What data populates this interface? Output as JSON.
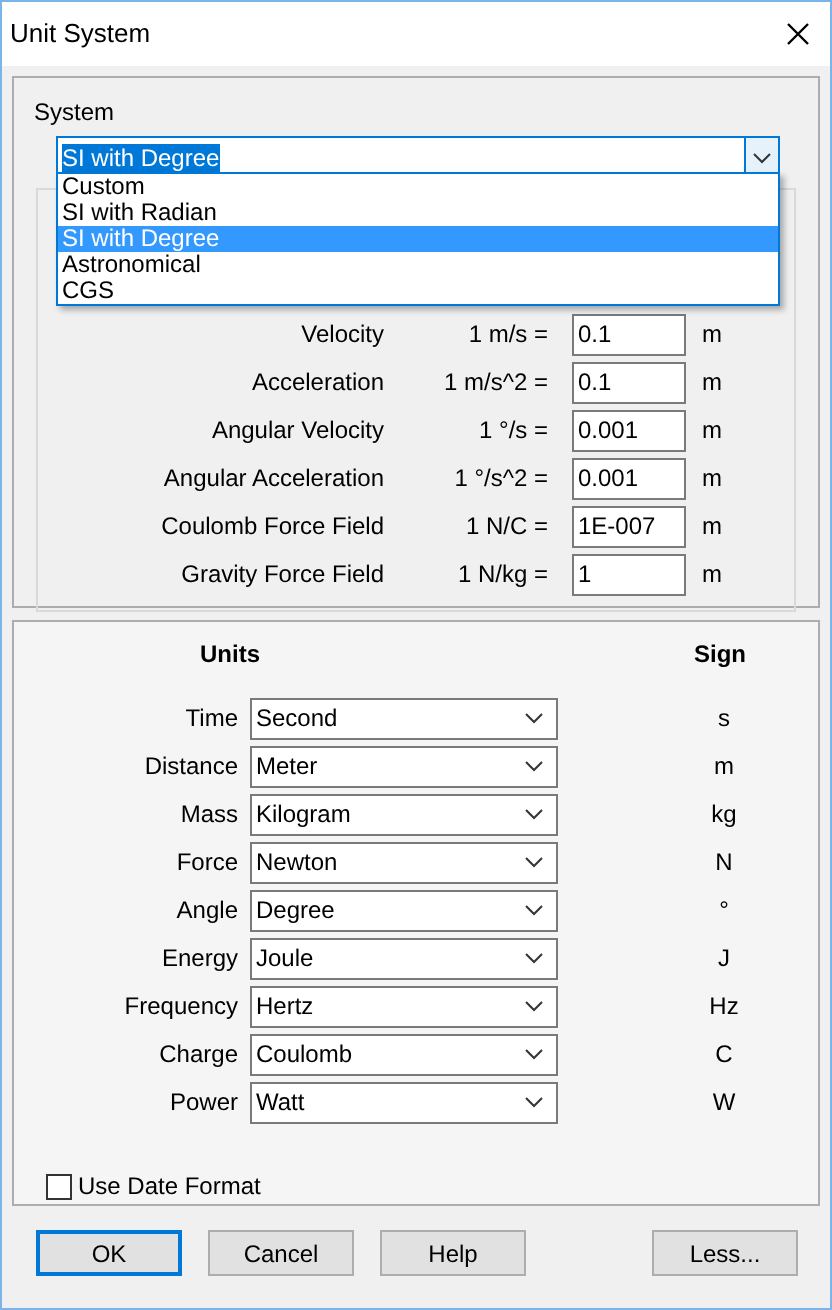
{
  "window": {
    "title": "Unit System"
  },
  "system": {
    "label": "System",
    "value": "SI with Degree",
    "expanded": true,
    "options": [
      {
        "label": "Custom",
        "selected": false
      },
      {
        "label": "SI with Radian",
        "selected": false
      },
      {
        "label": "SI with Degree",
        "selected": true
      },
      {
        "label": "Astronomical",
        "selected": false
      },
      {
        "label": "CGS",
        "selected": false
      }
    ]
  },
  "conversions": [
    {
      "label": "Velocity",
      "unit": "1 m/s =",
      "value": "0.1",
      "sign": "m"
    },
    {
      "label": "Acceleration",
      "unit": "1 m/s^2 =",
      "value": "0.1",
      "sign": "m"
    },
    {
      "label": "Angular Velocity",
      "unit": "1 °/s =",
      "value": "0.001",
      "sign": "m"
    },
    {
      "label": "Angular Acceleration",
      "unit": "1 °/s^2 =",
      "value": "0.001",
      "sign": "m"
    },
    {
      "label": "Coulomb Force Field",
      "unit": "1 N/C =",
      "value": "1E-007",
      "sign": "m"
    },
    {
      "label": "Gravity Force Field",
      "unit": "1 N/kg =",
      "value": "1",
      "sign": "m"
    }
  ],
  "units": {
    "header": "Units",
    "sign_header": "Sign",
    "rows": [
      {
        "label": "Time",
        "value": "Second",
        "sign": "s"
      },
      {
        "label": "Distance",
        "value": "Meter",
        "sign": "m"
      },
      {
        "label": "Mass",
        "value": "Kilogram",
        "sign": "kg"
      },
      {
        "label": "Force",
        "value": "Newton",
        "sign": "N"
      },
      {
        "label": "Angle",
        "value": "Degree",
        "sign": "°"
      },
      {
        "label": "Energy",
        "value": "Joule",
        "sign": "J"
      },
      {
        "label": "Frequency",
        "value": "Hertz",
        "sign": "Hz"
      },
      {
        "label": "Charge",
        "value": "Coulomb",
        "sign": "C"
      },
      {
        "label": "Power",
        "value": "Watt",
        "sign": "W"
      }
    ]
  },
  "use_date_format": {
    "label": "Use Date Format",
    "checked": false
  },
  "buttons": [
    {
      "label": "OK",
      "default": true
    },
    {
      "label": "Cancel",
      "default": false
    },
    {
      "label": "Help",
      "default": false
    },
    {
      "label": "Less...",
      "default": false
    }
  ]
}
